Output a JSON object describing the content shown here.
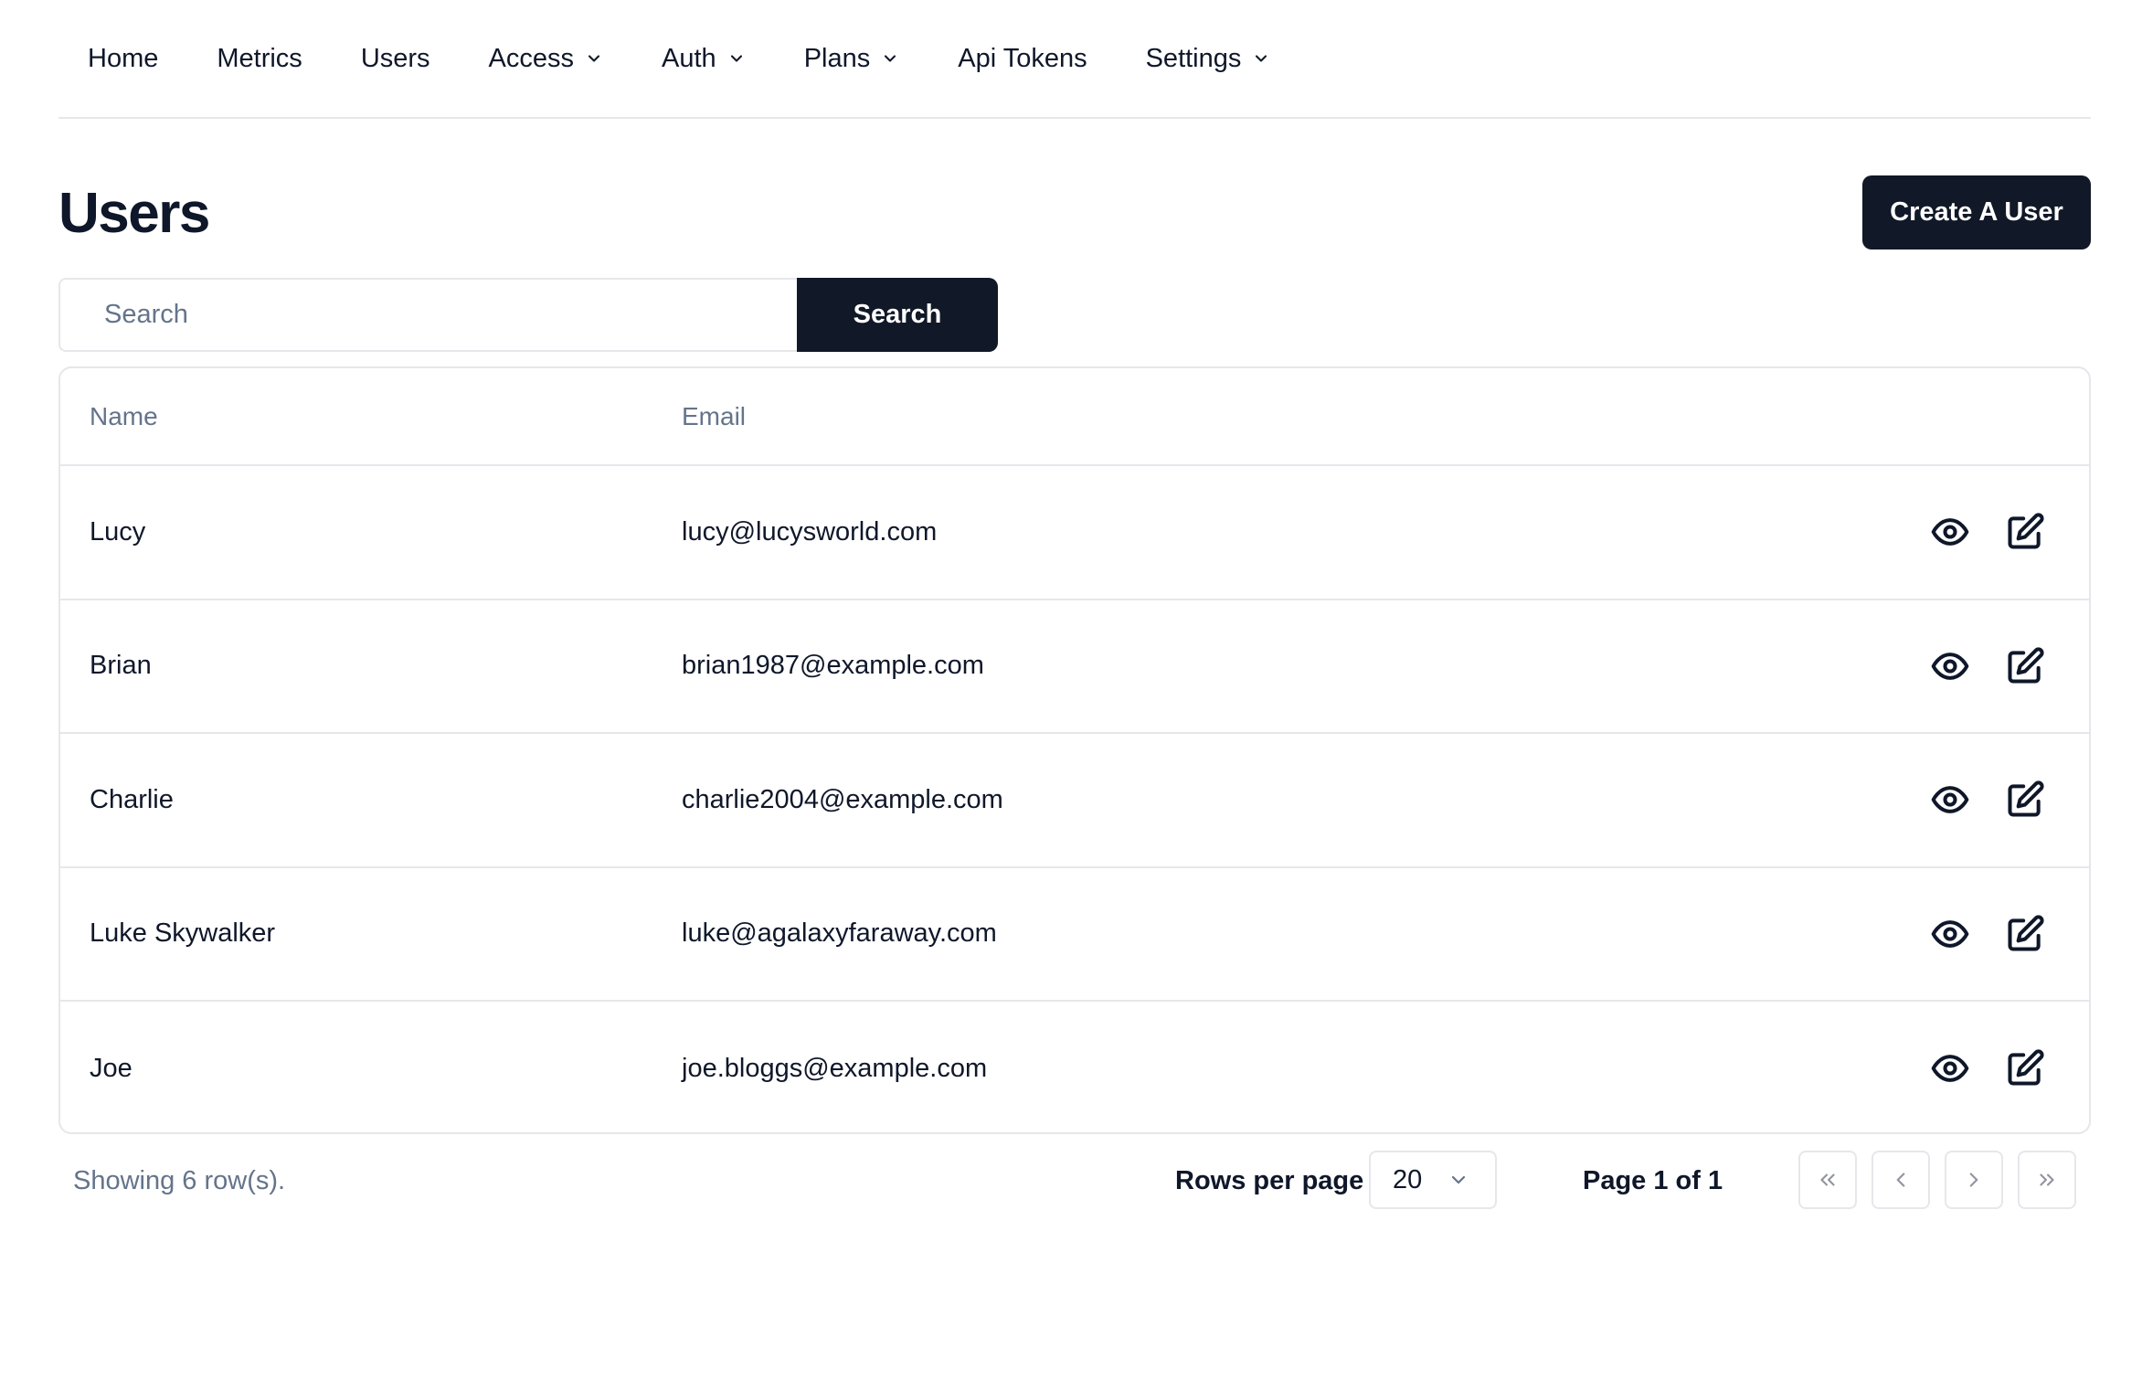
{
  "nav": {
    "items": [
      {
        "label": "Home",
        "dropdown": false
      },
      {
        "label": "Metrics",
        "dropdown": false
      },
      {
        "label": "Users",
        "dropdown": false
      },
      {
        "label": "Access",
        "dropdown": true
      },
      {
        "label": "Auth",
        "dropdown": true
      },
      {
        "label": "Plans",
        "dropdown": true
      },
      {
        "label": "Api Tokens",
        "dropdown": false
      },
      {
        "label": "Settings",
        "dropdown": true
      }
    ]
  },
  "header": {
    "title": "Users",
    "create_label": "Create A User"
  },
  "search": {
    "placeholder": "Search",
    "value": "",
    "button_label": "Search"
  },
  "table": {
    "columns": [
      "Name",
      "Email"
    ],
    "rows": [
      {
        "name": "Lucy",
        "email": "lucy@lucysworld.com"
      },
      {
        "name": "Brian",
        "email": "brian1987@example.com"
      },
      {
        "name": "Charlie",
        "email": "charlie2004@example.com"
      },
      {
        "name": "Luke Skywalker",
        "email": "luke@agalaxyfaraway.com"
      },
      {
        "name": "Joe",
        "email": "joe.bloggs@example.com"
      }
    ],
    "row_actions": [
      "eye-icon",
      "edit-icon"
    ]
  },
  "footer": {
    "showing": "Showing 6 row(s).",
    "rows_per_page_label": "Rows per page",
    "rows_per_page_value": "20",
    "page_info": "Page 1 of 1"
  },
  "colors": {
    "primary": "#111827",
    "muted_text": "#64748b",
    "border": "#e5e7eb"
  }
}
